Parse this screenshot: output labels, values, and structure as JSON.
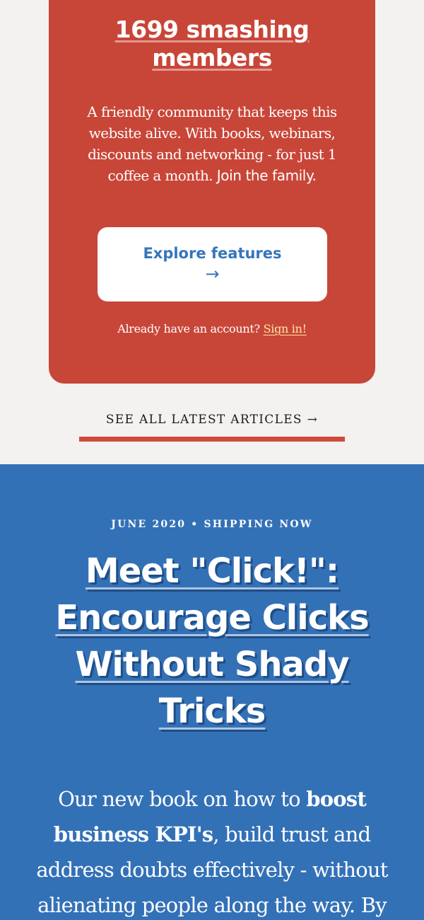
{
  "membership": {
    "title": "1699 smashing members",
    "description": "A friendly community that keeps this website alive. With books, webinars, discounts and networking - for just 1 coffee a month.",
    "join_text": "Join the family.",
    "explore_button_label": "Explore features",
    "explore_button_arrow": "→",
    "account_prompt": "Already have an account?",
    "sign_in_label": "Sign in!"
  },
  "articles_link": {
    "label": "SEE ALL LATEST ARTICLES →"
  },
  "book_promo": {
    "kicker": "JUNE 2020 • SHIPPING NOW",
    "title": "Meet \"Click!\": Encourage Clicks Without Shady Tricks",
    "description_intro": "Our new book on how to",
    "description_bold": "boost business KPI's",
    "description_rest": ", build trust and address doubts effectively - without alienating people along the way. By"
  },
  "colors": {
    "card_background": "#c84638",
    "page_background": "#f3f2f0",
    "accent_blue": "#3371b7",
    "underline_red": "#d04a3a"
  }
}
